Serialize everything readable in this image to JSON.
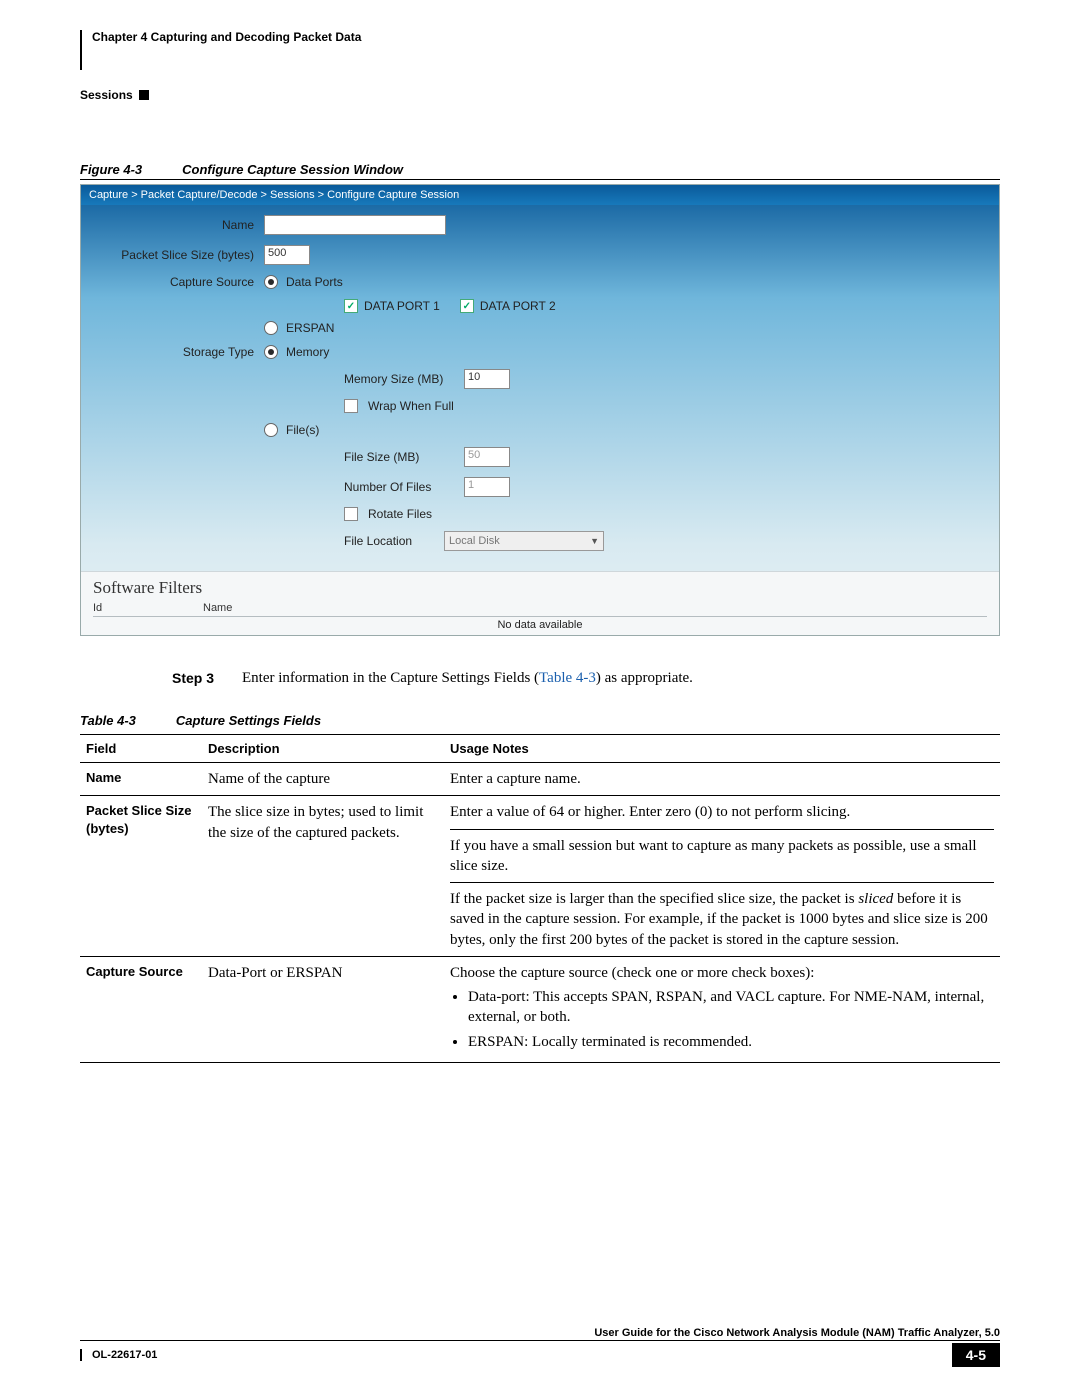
{
  "header": {
    "chapter": "Chapter 4    Capturing and Decoding Packet Data",
    "section": "Sessions"
  },
  "figure": {
    "num": "Figure 4-3",
    "title": "Configure Capture Session Window"
  },
  "screenshot": {
    "breadcrumb": "Capture > Packet Capture/Decode > Sessions > Configure Capture Session",
    "labels": {
      "name": "Name",
      "packet_slice": "Packet Slice Size (bytes)",
      "capture_source": "Capture Source",
      "storage_type": "Storage Type",
      "memory_size": "Memory Size (MB)",
      "wrap": "Wrap When Full",
      "file_size": "File Size (MB)",
      "num_files": "Number Of Files",
      "rotate": "Rotate Files",
      "file_location": "File Location"
    },
    "options": {
      "data_ports": "Data Ports",
      "erspan": "ERSPAN",
      "memory": "Memory",
      "files": "File(s)",
      "dp1": "DATA PORT 1",
      "dp2": "DATA PORT 2"
    },
    "values": {
      "slice": "500",
      "mem_size": "10",
      "file_size": "50",
      "num_files": "1",
      "file_location": "Local Disk"
    },
    "filters": {
      "title": "Software Filters",
      "col1": "Id",
      "col2": "Name",
      "msg": "No data available"
    }
  },
  "step": {
    "label": "Step 3",
    "text_before": "Enter information in the Capture Settings Fields (",
    "link": "Table 4-3",
    "text_after": ") as appropriate."
  },
  "table_caption": {
    "num": "Table 4-3",
    "title": "Capture Settings Fields"
  },
  "table": {
    "headers": {
      "field": "Field",
      "desc": "Description",
      "usage": "Usage Notes"
    },
    "rows": [
      {
        "field": "Name",
        "desc": "Name of the capture",
        "usage1": "Enter a capture name."
      },
      {
        "field": "Packet Slice Size (bytes)",
        "desc": "The slice size in bytes; used to limit the size of the captured packets.",
        "usage1": "Enter a value of 64 or higher. Enter zero (0) to not perform slicing.",
        "usage2": "If you have a small session but want to capture as many packets as possible, use a small slice size.",
        "usage3a": "If the packet size is larger than the specified slice size, the packet is ",
        "usage3i": "sliced",
        "usage3b": " before it is saved in the capture session. For example, if the packet is 1000 bytes and slice size is 200 bytes, only the first 200 bytes of the packet is stored in the capture session."
      },
      {
        "field": "Capture Source",
        "desc": "Data-Port or ERSPAN",
        "usage1": "Choose the capture source (check one or more check boxes):",
        "bullet1": "Data-port: This accepts SPAN, RSPAN, and VACL capture. For NME-NAM, internal, external, or both.",
        "bullet2": "ERSPAN: Locally terminated is recommended."
      }
    ]
  },
  "footer": {
    "guide": "User Guide for the Cisco Network Analysis Module (NAM) Traffic Analyzer, 5.0",
    "code": "OL-22617-01",
    "page": "4-5"
  }
}
